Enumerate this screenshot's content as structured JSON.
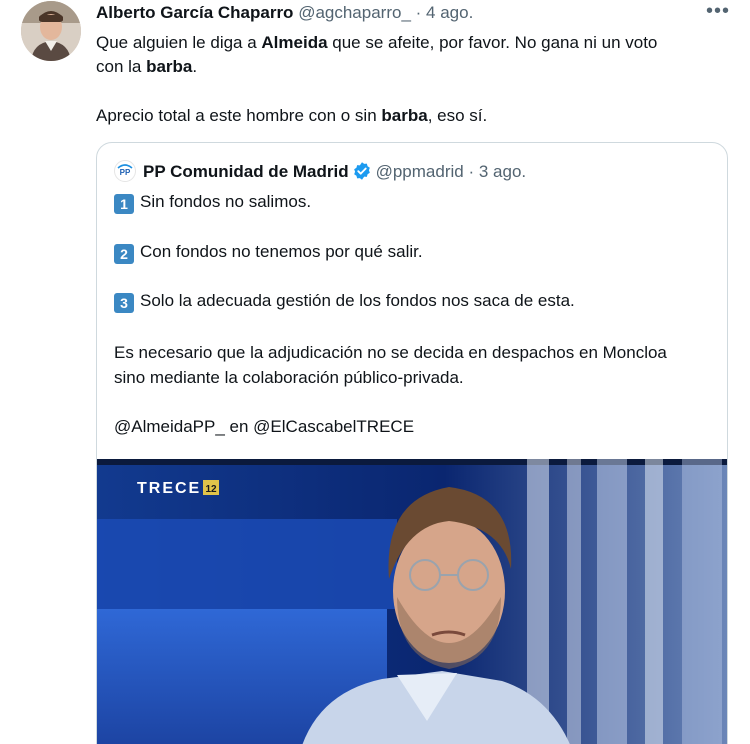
{
  "tweet": {
    "author_name": "Alberto García Chaparro",
    "handle": "@agchaparro_",
    "separator": "·",
    "date": "4 ago.",
    "more_label": "•••",
    "text_line1_a": "Que alguien le diga a ",
    "text_line1_bold": "Almeida",
    "text_line1_b": " que se afeite, por favor. No gana ni un voto",
    "text_line2_a": "con la ",
    "text_line2_bold": "barba",
    "text_line2_b": ".",
    "text_line3_a": "Aprecio total a este hombre con o sin ",
    "text_line3_bold": "barba",
    "text_line3_b": ", eso sí."
  },
  "quoted": {
    "avatar_text": "PP",
    "author_name": "PP Comunidad de Madrid",
    "handle": "@ppmadrid",
    "separator": "·",
    "date": "3 ago.",
    "items": [
      {
        "num": "1",
        "text": "Sin fondos no salimos."
      },
      {
        "num": "2",
        "text": "Con fondos no tenemos por qué salir."
      },
      {
        "num": "3",
        "text": "Solo la adecuada gestión de los fondos nos saca de esta."
      }
    ],
    "para_line1": "Es necesario que la adjudicación no se decida en despachos en Moncloa",
    "para_line2": "sino mediante la colaboración público-privada.",
    "mention1": "@AlmeidaPP_",
    "mention_sep": " en ",
    "mention2": "@ElCascabelTRECE",
    "media": {
      "channel_logo": "TRECE",
      "channel_badge": "12",
      "accent": "#1c4fbf"
    }
  },
  "colors": {
    "text": "#0f1419",
    "secondary": "#536471",
    "border": "#cfd9de",
    "verified": "#1d9bf0",
    "keycap": "#3b88c3"
  }
}
